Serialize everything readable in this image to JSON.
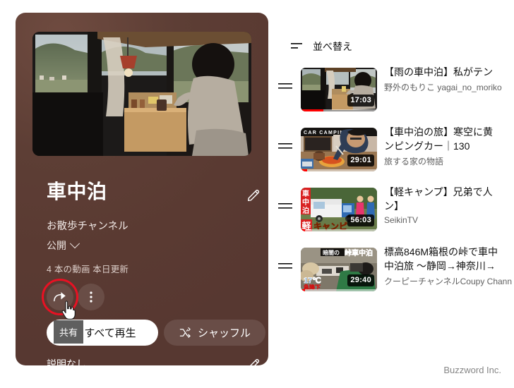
{
  "playlist": {
    "title": "車中泊",
    "channel": "お散歩チャンネル",
    "visibility": "公開",
    "meta": "4 本の動画  本日更新",
    "description": "説明なし",
    "play_all_label": "すべて再生",
    "shuffle_label": "シャッフル",
    "share_tooltip": "共有",
    "icons": {
      "share": "share-icon",
      "more": "more-vertical-icon",
      "edit_title": "pencil-edit-icon",
      "edit_description": "pencil-edit-icon",
      "shuffle": "shuffle-icon",
      "visibility_chevron": "chevron-down-icon"
    },
    "highlight_color": "#e81123",
    "panel_color": "#5d3e35"
  },
  "sidebar": {
    "sort_label": "並べ替え",
    "sort_icon": "sort-icon"
  },
  "videos": [
    {
      "title_lines": [
        "【雨の車中泊】私がテン"
      ],
      "channel": "野外のもりこ yagai_no_moriko",
      "duration": "17:03",
      "progress_percent": 30,
      "drag_handle": "drag-handle-icon"
    },
    {
      "title_lines": [
        "【車中泊の旅】寒空に黄",
        "ンピングカー｜130"
      ],
      "channel": "旅する家の物語",
      "duration": "29:01",
      "progress_percent": 8,
      "drag_handle": "drag-handle-icon"
    },
    {
      "title_lines": [
        "【軽キャンプ】兄弟で人",
        "ン】"
      ],
      "channel": "SeikinTV",
      "duration": "56:03",
      "progress_percent": 6,
      "drag_handle": "drag-handle-icon"
    },
    {
      "title_lines": [
        "標高846M箱根の峠で車中",
        "中泊旅 〜静岡→神奈川→"
      ],
      "channel": "クーピーチャンネルCoupy Chann",
      "duration": "29:40",
      "progress_percent": 6,
      "drag_handle": "drag-handle-icon"
    }
  ],
  "footer": {
    "watermark": "Buzzword Inc."
  }
}
